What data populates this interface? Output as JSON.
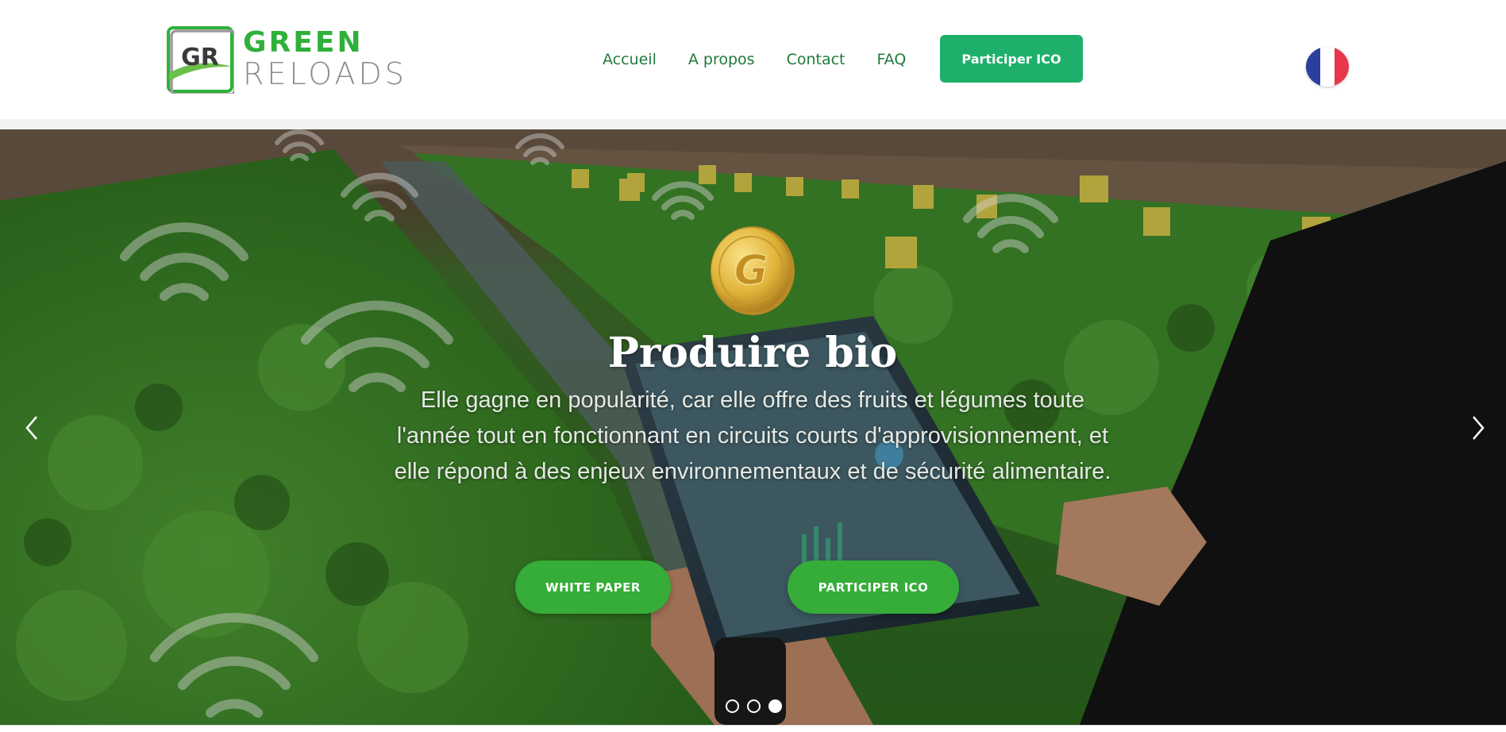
{
  "brand": {
    "line1": "GREEN",
    "line2": "RELOADS",
    "mark": "GR",
    "colors": {
      "green": "#2fb03a",
      "grey": "#8c8c8c"
    }
  },
  "nav": {
    "items": [
      "Accueil",
      "A propos",
      "Contact",
      "FAQ"
    ],
    "cta_label": "Participer ICO",
    "cta_color": "#1eb06a",
    "language_icon": "french-flag-icon"
  },
  "hero": {
    "coin_icon": "gold-coin-icon",
    "coin_letter": "G",
    "title": "Produire bio",
    "text": "Elle gagne en popularité, car elle offre des fruits et légumes toute l'année tout en fonctionnant en circuits courts d'approvisionnement, et elle répond à des enjeux environnementaux et de sécurité alimentaire.",
    "buttons": {
      "white_paper": "WHITE PAPER",
      "participate": "PARTICIPER ICO"
    },
    "button_color": "#35ad38",
    "prev_icon": "chevron-left-icon",
    "next_icon": "chevron-right-icon",
    "slides_total": 3,
    "active_slide": 3
  }
}
